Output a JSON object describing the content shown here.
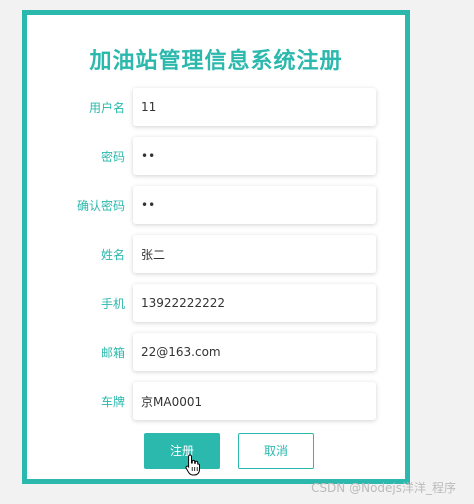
{
  "title": "加油站管理信息系统注册",
  "form": {
    "fields": [
      {
        "label": "用户名",
        "value": "11"
      },
      {
        "label": "密码",
        "value": "••"
      },
      {
        "label": "确认密码",
        "value": "••"
      },
      {
        "label": "姓名",
        "value": "张二"
      },
      {
        "label": "手机",
        "value": "13922222222"
      },
      {
        "label": "邮箱",
        "value": "22@163.com"
      },
      {
        "label": "车牌",
        "value": "京MA0001"
      }
    ]
  },
  "buttons": {
    "register": "注册",
    "cancel": "取消"
  },
  "watermark": "CSDN @Nodejs洋洋_程序",
  "colors": {
    "accent": "#2bb8ad",
    "background": "#f2f2f2"
  }
}
